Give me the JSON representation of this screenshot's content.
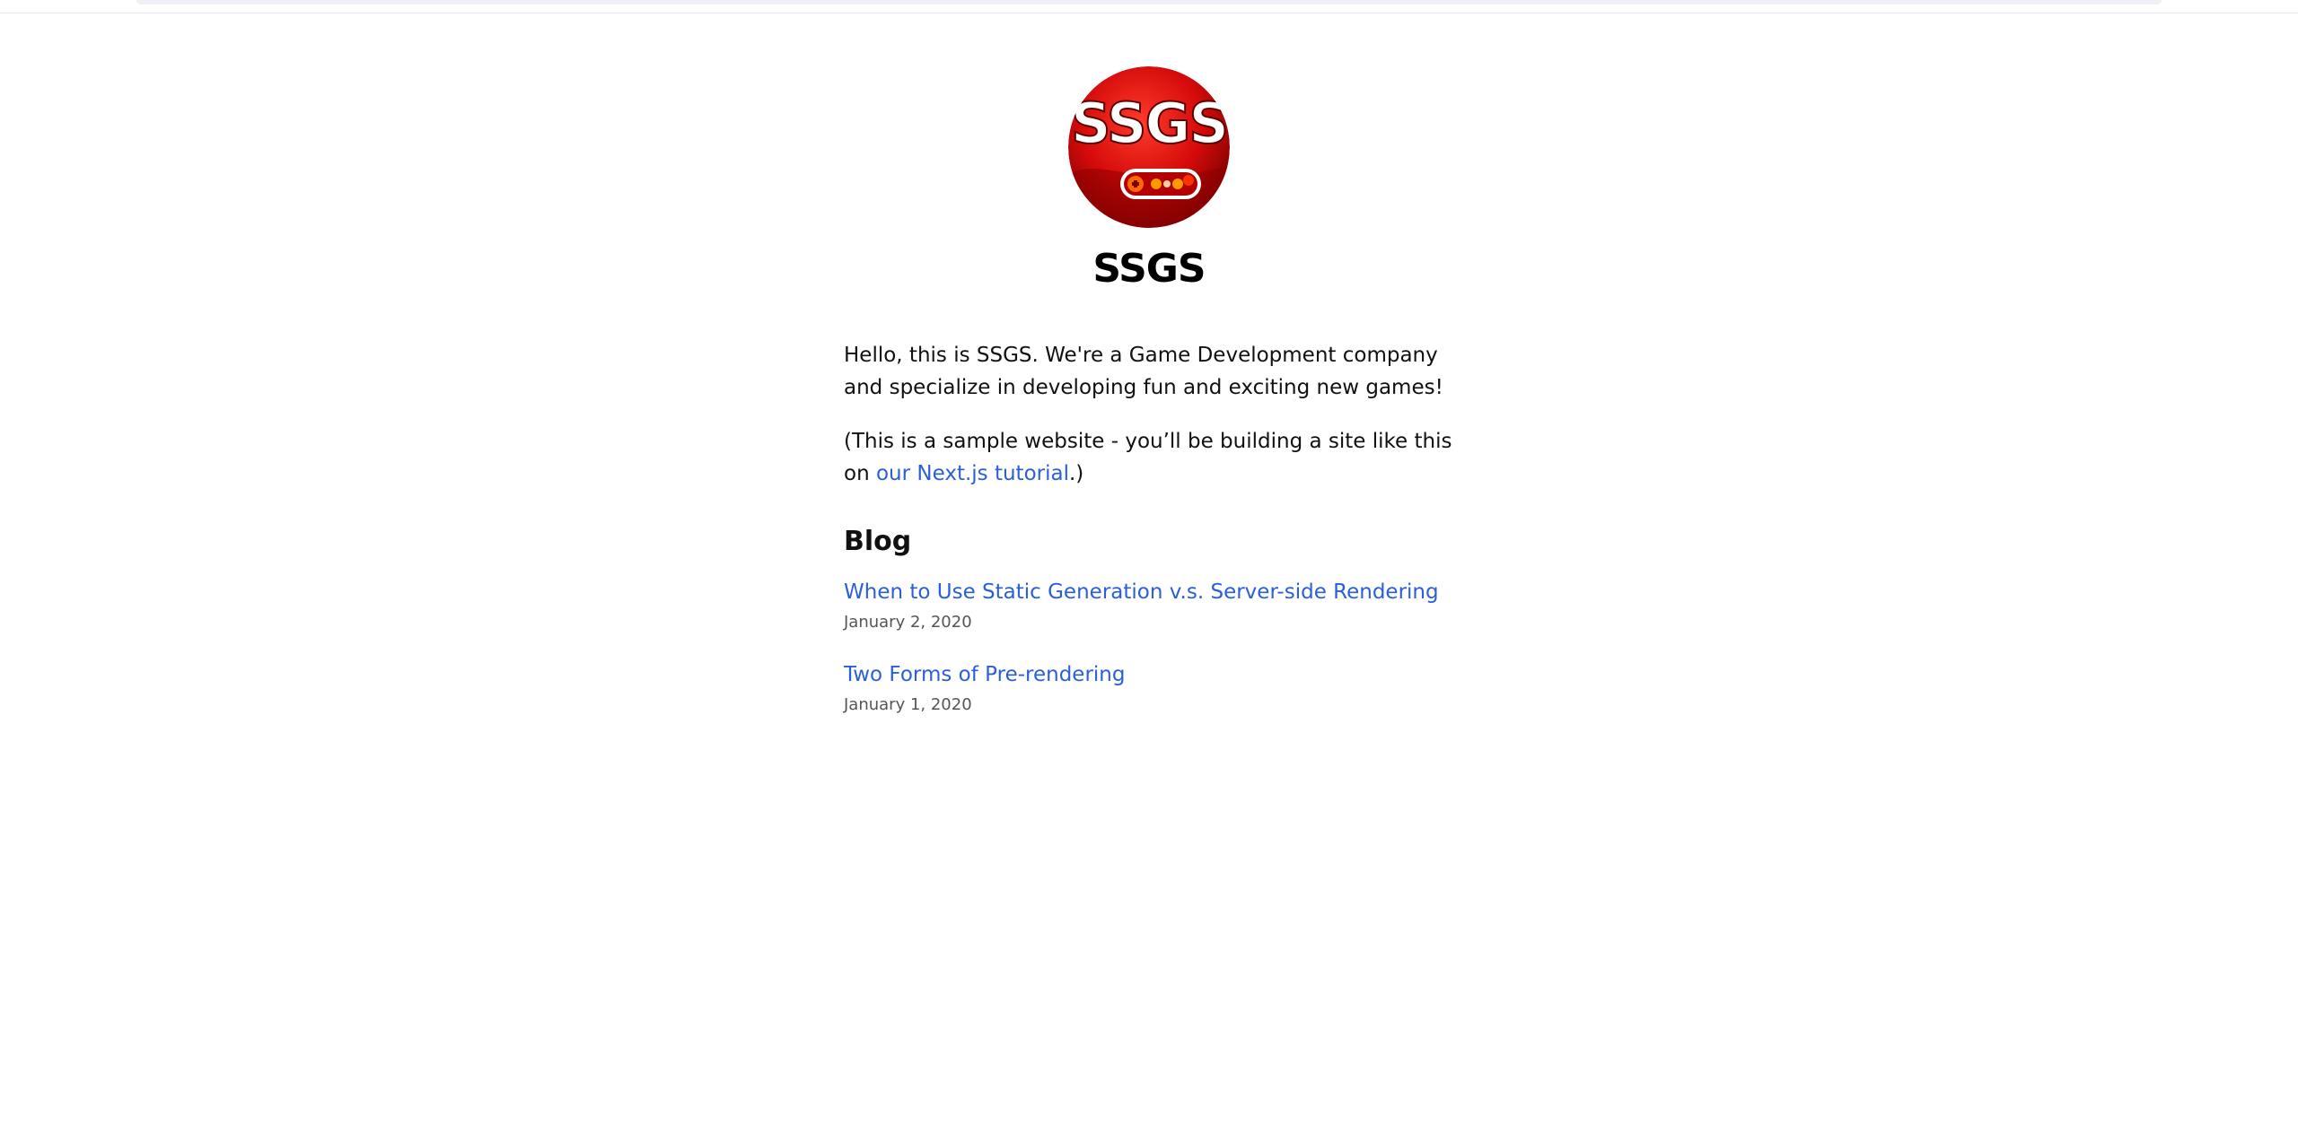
{
  "site": {
    "name": "SSGS",
    "logo_text": "SSGS"
  },
  "intro": {
    "paragraph1": "Hello, this is SSGS. We're a Game Development company and specialize in developing fun and exciting new games!",
    "paragraph2_prefix": "(This is a sample website - you’ll be building a site like this on ",
    "tutorial_link": "our Next.js tutorial",
    "paragraph2_suffix": ".)"
  },
  "blog": {
    "heading": "Blog",
    "posts": [
      {
        "title": "When to Use Static Generation v.s. Server-side Rendering",
        "date": "January 2, 2020"
      },
      {
        "title": "Two Forms of Pre-rendering",
        "date": "January 1, 2020"
      }
    ]
  },
  "colors": {
    "link": "#2b5fd9",
    "logo_red": "#d40a0a"
  }
}
